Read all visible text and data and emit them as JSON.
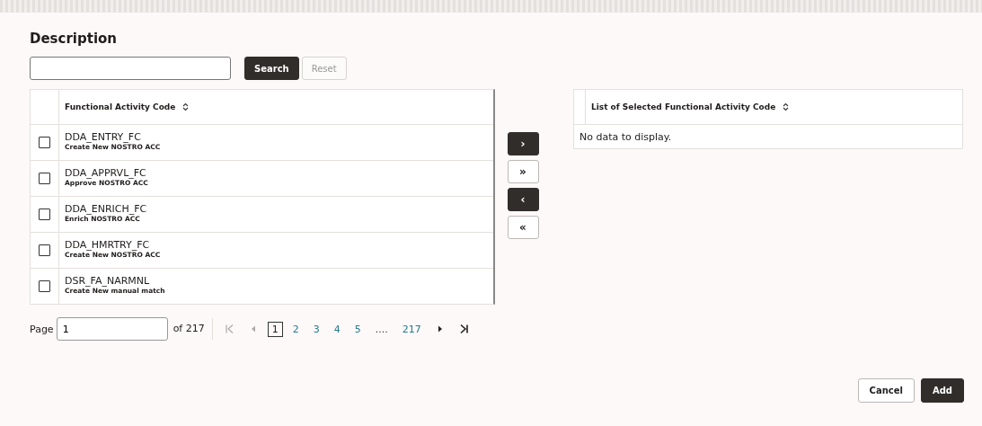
{
  "title": "Description",
  "search": {
    "buttons": [
      {
        "label": "Search",
        "kind": "primary",
        "disabled": false
      },
      {
        "label": "Reset",
        "kind": "secondary",
        "disabled": true
      }
    ]
  },
  "available": {
    "column": "Functional Activity Code",
    "rows": [
      {
        "code": "DDA_ENTRY_FC",
        "description": "Create New NOSTRO ACC",
        "checked": false
      },
      {
        "code": "DDA_APPRVL_FC",
        "description": "Approve NOSTRO ACC",
        "checked": false
      },
      {
        "code": "DDA_ENRICH_FC",
        "description": "Enrich NOSTRO ACC",
        "checked": false
      },
      {
        "code": "DDA_HMRTRY_FC",
        "description": "Create New NOSTRO ACC",
        "checked": false
      },
      {
        "code": "DSR_FA_NARMNL",
        "description": "Create New manual match",
        "checked": false
      }
    ]
  },
  "transfer_buttons": [
    {
      "label": "›",
      "kind": "primary"
    },
    {
      "label": "»",
      "kind": "secondary"
    },
    {
      "label": "‹",
      "kind": "primary"
    },
    {
      "label": "«",
      "kind": "secondary"
    }
  ],
  "selected_list": {
    "column": "List of Selected Functional Activity Code",
    "empty_text": "No data to display."
  },
  "pagination": {
    "label": "Page",
    "value": "1",
    "of_text": "of 217",
    "first_disabled": true,
    "prev_disabled": true,
    "pages": [
      {
        "label": "1",
        "selected": true
      },
      {
        "label": "2",
        "selected": false
      },
      {
        "label": "3",
        "selected": false
      },
      {
        "label": "4",
        "selected": false
      },
      {
        "label": "5",
        "selected": false
      },
      {
        "label": "....",
        "kind": "ellipsis",
        "selected": false
      },
      {
        "label": "217",
        "selected": false
      }
    ]
  },
  "footer_buttons": [
    {
      "label": "Cancel",
      "kind": "secondary"
    },
    {
      "label": "Add",
      "kind": "primary"
    }
  ]
}
